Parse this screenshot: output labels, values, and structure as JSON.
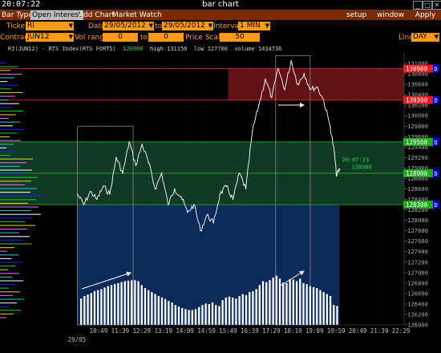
{
  "header": {
    "clock": "20:07:22",
    "title": "bar chart"
  },
  "menubar": {
    "items": [
      "Bar Type",
      "Open Interest",
      "Add Chart",
      "Market Watch"
    ],
    "active": "Open Interest",
    "right": [
      "setup",
      "window"
    ],
    "apply": "Apply"
  },
  "controls": {
    "ticker_label": "Ticker",
    "ticker": "RI",
    "date_label": "Date",
    "date_from": "29/05/2012",
    "to_label": "to",
    "date_to": "29/05/2012",
    "interval_label": "Interval",
    "interval": "1 MIN",
    "contract_label": "Contract",
    "contract": "JUN12",
    "vol_range_label": "Vol range",
    "vol_from": "0",
    "vol_to_label": "to",
    "vol_to": "0",
    "price_scale_label": "Price Scale",
    "price_scale": "50",
    "line_label": "Line",
    "line": "DAY"
  },
  "info": {
    "symbol": "RI(JUN12) - RTS Index(RTS FORTS)",
    "current": "128980",
    "high_label": "high",
    "high": "131150",
    "low_label": "low",
    "low": "127700",
    "volume_label": "volume",
    "volume": "1434736"
  },
  "colors": {
    "price_line": "#ffffff",
    "volume_bar": "#ffffff",
    "background": "#000000",
    "red_zone": "#6b1418",
    "green_zone": "#123f2a",
    "blue_zone": "#0c2a5a",
    "red_level": "#ee1c24",
    "green_level": "#22aa22",
    "label_blue": "#0000cc",
    "profile_colors": [
      "#2222ff",
      "#22cc22",
      "#dddd22",
      "#ff66ff",
      "#22cccc",
      "#ffffff"
    ]
  },
  "chart_data": {
    "type": "line",
    "title": "",
    "x_ticks": [
      "10:49",
      "11:39",
      "12:29",
      "13:19",
      "14:09",
      "14:59",
      "15:49",
      "16:39",
      "17:29",
      "18:19",
      "19:09",
      "19:59",
      "20:49",
      "21:39",
      "22:29"
    ],
    "date_label": "29/05",
    "ylim": [
      126000,
      131200
    ],
    "y_ticks": [
      126000,
      126200,
      126400,
      126600,
      126800,
      127000,
      127200,
      127400,
      127600,
      127800,
      128000,
      128200,
      128400,
      128600,
      128800,
      129000,
      129200,
      129400,
      129600,
      129800,
      130000,
      130200,
      130400,
      130600,
      130800,
      131000
    ],
    "series": [
      {
        "x": [
          "10:00",
          "10:15",
          "10:30",
          "10:45",
          "11:00",
          "11:15",
          "11:30",
          "11:45",
          "12:00",
          "12:15",
          "12:30",
          "12:45",
          "13:00",
          "13:15",
          "13:30",
          "13:45",
          "14:00",
          "14:15",
          "14:30",
          "14:45",
          "15:00",
          "15:15",
          "15:30",
          "15:45",
          "16:00",
          "16:15",
          "16:30",
          "16:45",
          "17:00",
          "17:15",
          "17:30",
          "17:45",
          "18:00",
          "18:15",
          "18:30",
          "18:45",
          "19:00",
          "19:15",
          "19:30",
          "19:45",
          "19:55",
          "20:00",
          "20:07"
        ],
        "values": [
          128500,
          128300,
          128550,
          128400,
          128650,
          128500,
          129200,
          128900,
          129500,
          129050,
          129450,
          129100,
          128600,
          128900,
          128300,
          128600,
          128450,
          128150,
          128300,
          127800,
          128100,
          127950,
          128500,
          128650,
          128400,
          128900,
          128600,
          129700,
          130200,
          130700,
          130350,
          130900,
          130500,
          131050,
          130600,
          130800,
          130500,
          130550,
          130300,
          129800,
          129300,
          128850,
          128980
        ]
      }
    ],
    "volume": [
      0.53,
      0.58,
      0.61,
      0.64,
      0.68,
      0.7,
      0.72,
      0.75,
      0.78,
      0.8,
      0.82,
      0.84,
      0.86,
      0.88,
      0.89,
      0.9,
      0.9,
      0.88,
      0.8,
      0.74,
      0.7,
      0.66,
      0.62,
      0.58,
      0.55,
      0.52,
      0.48,
      0.45,
      0.4,
      0.37,
      0.34,
      0.32,
      0.3,
      0.3,
      0.32,
      0.36,
      0.4,
      0.43,
      0.42,
      0.45,
      0.4,
      0.38,
      0.5,
      0.55,
      0.57,
      0.55,
      0.53,
      0.58,
      0.62,
      0.6,
      0.66,
      0.68,
      0.72,
      0.8,
      0.88,
      0.86,
      0.9,
      0.95,
      0.99,
      0.93,
      0.85,
      0.84,
      0.92,
      0.91,
      0.88,
      0.93,
      0.84,
      0.82,
      0.78,
      0.76,
      0.74,
      0.7,
      0.66,
      0.62,
      0.58,
      0.4,
      0.38
    ],
    "levels": [
      {
        "price": 130900,
        "label": "130900",
        "color": "red",
        "flag": "D"
      },
      {
        "price": 130300,
        "label": "130300",
        "color": "red",
        "flag": "D"
      },
      {
        "price": 129500,
        "label": "129500",
        "color": "green",
        "flag": "D"
      },
      {
        "price": 128900,
        "label": "128900",
        "color": "green",
        "flag": "D"
      },
      {
        "price": 128300,
        "label": "128300",
        "color": "green",
        "flag": "D"
      }
    ],
    "zones": [
      {
        "from": 130300,
        "to": 130900,
        "color": "red"
      },
      {
        "from": 128300,
        "to": 129500,
        "color": "green"
      }
    ],
    "last_marker": {
      "time": "20:07:23",
      "price": "128980"
    }
  }
}
